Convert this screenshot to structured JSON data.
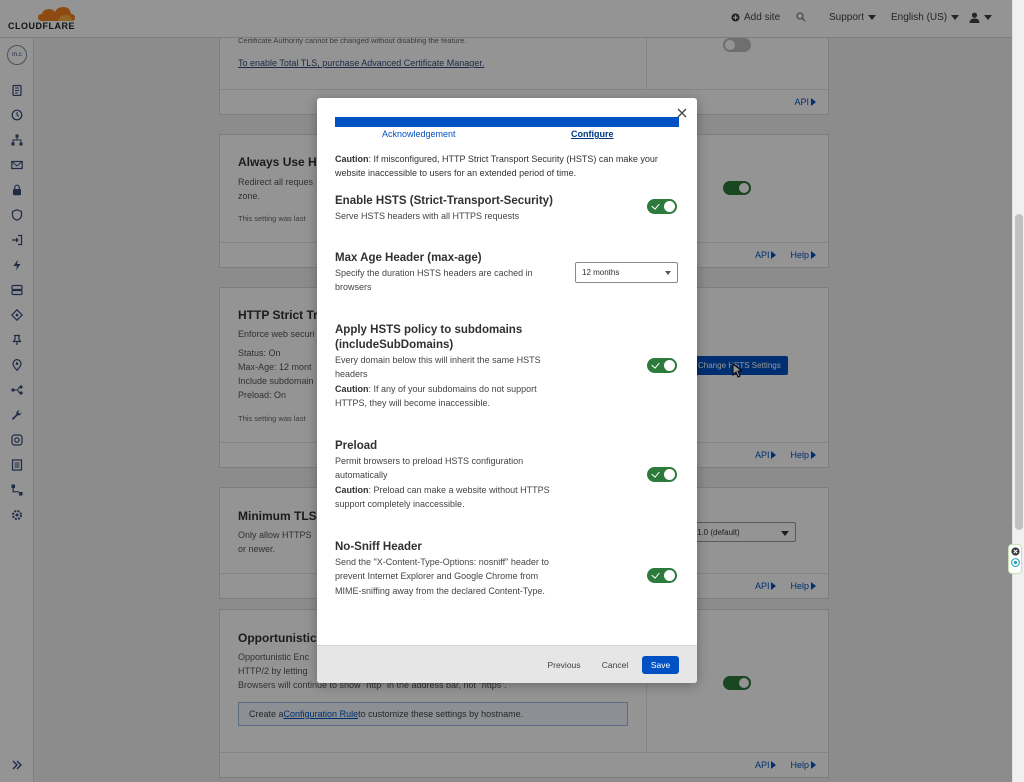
{
  "brand": {
    "name": "CLOUDFLARE",
    "orange": "#f38020"
  },
  "topbar": {
    "add_site": "Add site",
    "support": "Support",
    "language": "English (US)"
  },
  "account": {
    "initials": "m.c"
  },
  "rail": {
    "icons": [
      "clipboard-icon",
      "clock-icon",
      "network-icon",
      "email-icon",
      "lock-icon",
      "shield-icon",
      "login-icon",
      "lightning-icon",
      "storage-icon",
      "tag-icon",
      "pin-icon",
      "location-icon",
      "route-icon",
      "wrench-icon",
      "camera-icon",
      "page-icon",
      "workflow-icon",
      "gear-shield-icon"
    ],
    "expand": "chevrons-right-icon"
  },
  "background": {
    "card1": {
      "note": "Certificate Authority cannot be changed without disabling the feature.",
      "link": "To enable Total TLS, purchase Advanced Certificate Manager.",
      "footer_api": "API"
    },
    "card2": {
      "title": "Always Use HT",
      "line1": "Redirect all reques",
      "line2": "zone.",
      "small": "This setting was last",
      "footer_api": "API",
      "footer_help": "Help"
    },
    "card3": {
      "title": "HTTP Strict Tra",
      "line1": "Enforce web securi",
      "status": "Status: On",
      "max_age": "Max-Age: 12 mont",
      "include": "Include subdomain",
      "preload": "Preload: On",
      "small": "This setting was last",
      "button": "Change HSTS Settings",
      "footer_api": "API",
      "footer_help": "Help"
    },
    "card4": {
      "title": "Minimum TLS",
      "line1": "Only allow HTTPS",
      "line2": "or newer.",
      "select": "1.0 (default)",
      "footer_api": "API",
      "footer_help": "Help"
    },
    "card5": {
      "title": "Opportunistic",
      "line1": "Opportunistic Enc",
      "line2": "HTTP/2 by letting",
      "line3": "Browsers will continue to show \"http\" in the address bar, not \"https\".",
      "hint_pre": "Create a ",
      "hint_link": "Configuration Rule",
      "hint_post": " to customize these settings by hostname.",
      "footer_api": "API",
      "footer_help": "Help"
    }
  },
  "modal": {
    "steps": [
      "Acknowledgement",
      "Configure"
    ],
    "active_step": "Configure",
    "caution_label": "Caution",
    "caution_text": ": If misconfigured, HTTP Strict Transport Security (HSTS) can make your website inaccessible to users for an extended period of time.",
    "settings": {
      "enable": {
        "title": "Enable HSTS (Strict-Transport-Security)",
        "desc": "Serve HSTS headers with all HTTPS requests",
        "enabled": true
      },
      "max_age": {
        "title": "Max Age Header (max-age)",
        "desc": "Specify the duration HSTS headers are cached in browsers",
        "value": "12 months"
      },
      "subdomains": {
        "title": "Apply HSTS policy to subdomains (includeSubDomains)",
        "desc": "Every domain below this will inherit the same HSTS headers",
        "caution_label": "Caution",
        "caution_text": ": If any of your subdomains do not support HTTPS, they will become inaccessible.",
        "enabled": true
      },
      "preload": {
        "title": "Preload",
        "desc": "Permit browsers to preload HSTS configuration automatically",
        "caution_label": "Caution",
        "caution_text": ": Preload can make a website without HTTPS support completely inaccessible.",
        "enabled": true
      },
      "nosniff": {
        "title": "No-Sniff Header",
        "desc": "Send the \"X-Content-Type-Options: nosniff\" header to prevent Internet Explorer and Google Chrome from MIME-sniffing away from the declared Content-Type.",
        "enabled": true
      }
    },
    "buttons": {
      "previous": "Previous",
      "cancel": "Cancel",
      "save": "Save"
    }
  },
  "colors": {
    "primary": "#0051c3",
    "toggle_on": "#2c7a3c"
  }
}
